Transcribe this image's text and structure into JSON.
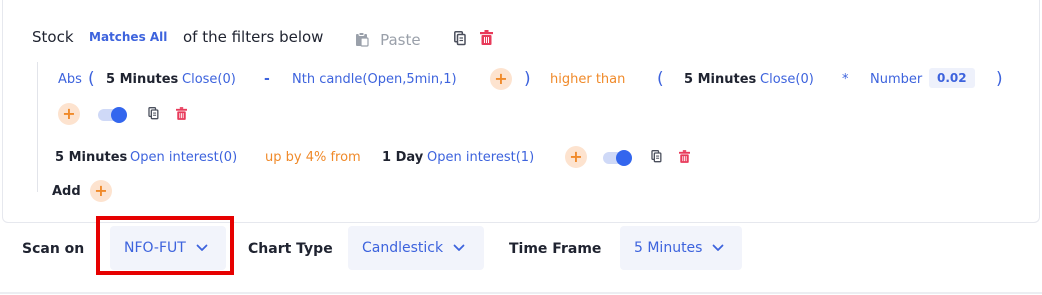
{
  "header": {
    "stock": "Stock",
    "matches": "Matches All",
    "of_filters": "of the filters below",
    "paste": "Paste"
  },
  "filter1": {
    "abs": "Abs",
    "open_paren": "(",
    "timeframe1": "5 Minutes",
    "close1": "Close(0)",
    "minus": "-",
    "nth_candle": "Nth candle(Open,5min,1)",
    "close_paren": ")",
    "comparator": "higher than",
    "open_paren2": "(",
    "timeframe2": "5 Minutes",
    "close2": "Close(0)",
    "times": "*",
    "number_label": "Number",
    "number_value": "0.02",
    "close_paren2": ")"
  },
  "filter2": {
    "timeframe1": "5 Minutes",
    "oi1": "Open interest(0)",
    "comparator": "up by 4% from",
    "timeframe2": "1 Day",
    "oi2": "Open interest(1)"
  },
  "add_label": "Add",
  "footer": {
    "scan_on_label": "Scan on",
    "scan_on_value": "NFO-FUT",
    "chart_type_label": "Chart Type",
    "chart_type_value": "Candlestick",
    "time_frame_label": "Time Frame",
    "time_frame_value": "5 Minutes"
  },
  "icons": {
    "paste": "clipboard-icon",
    "copy": "copy-icon",
    "delete": "trash-icon",
    "chevron": "chevron-down-icon"
  },
  "colors": {
    "blue": "#3d63dd",
    "orange": "#f08a2a",
    "red": "#e83a5a",
    "highlight": "#e60000"
  }
}
